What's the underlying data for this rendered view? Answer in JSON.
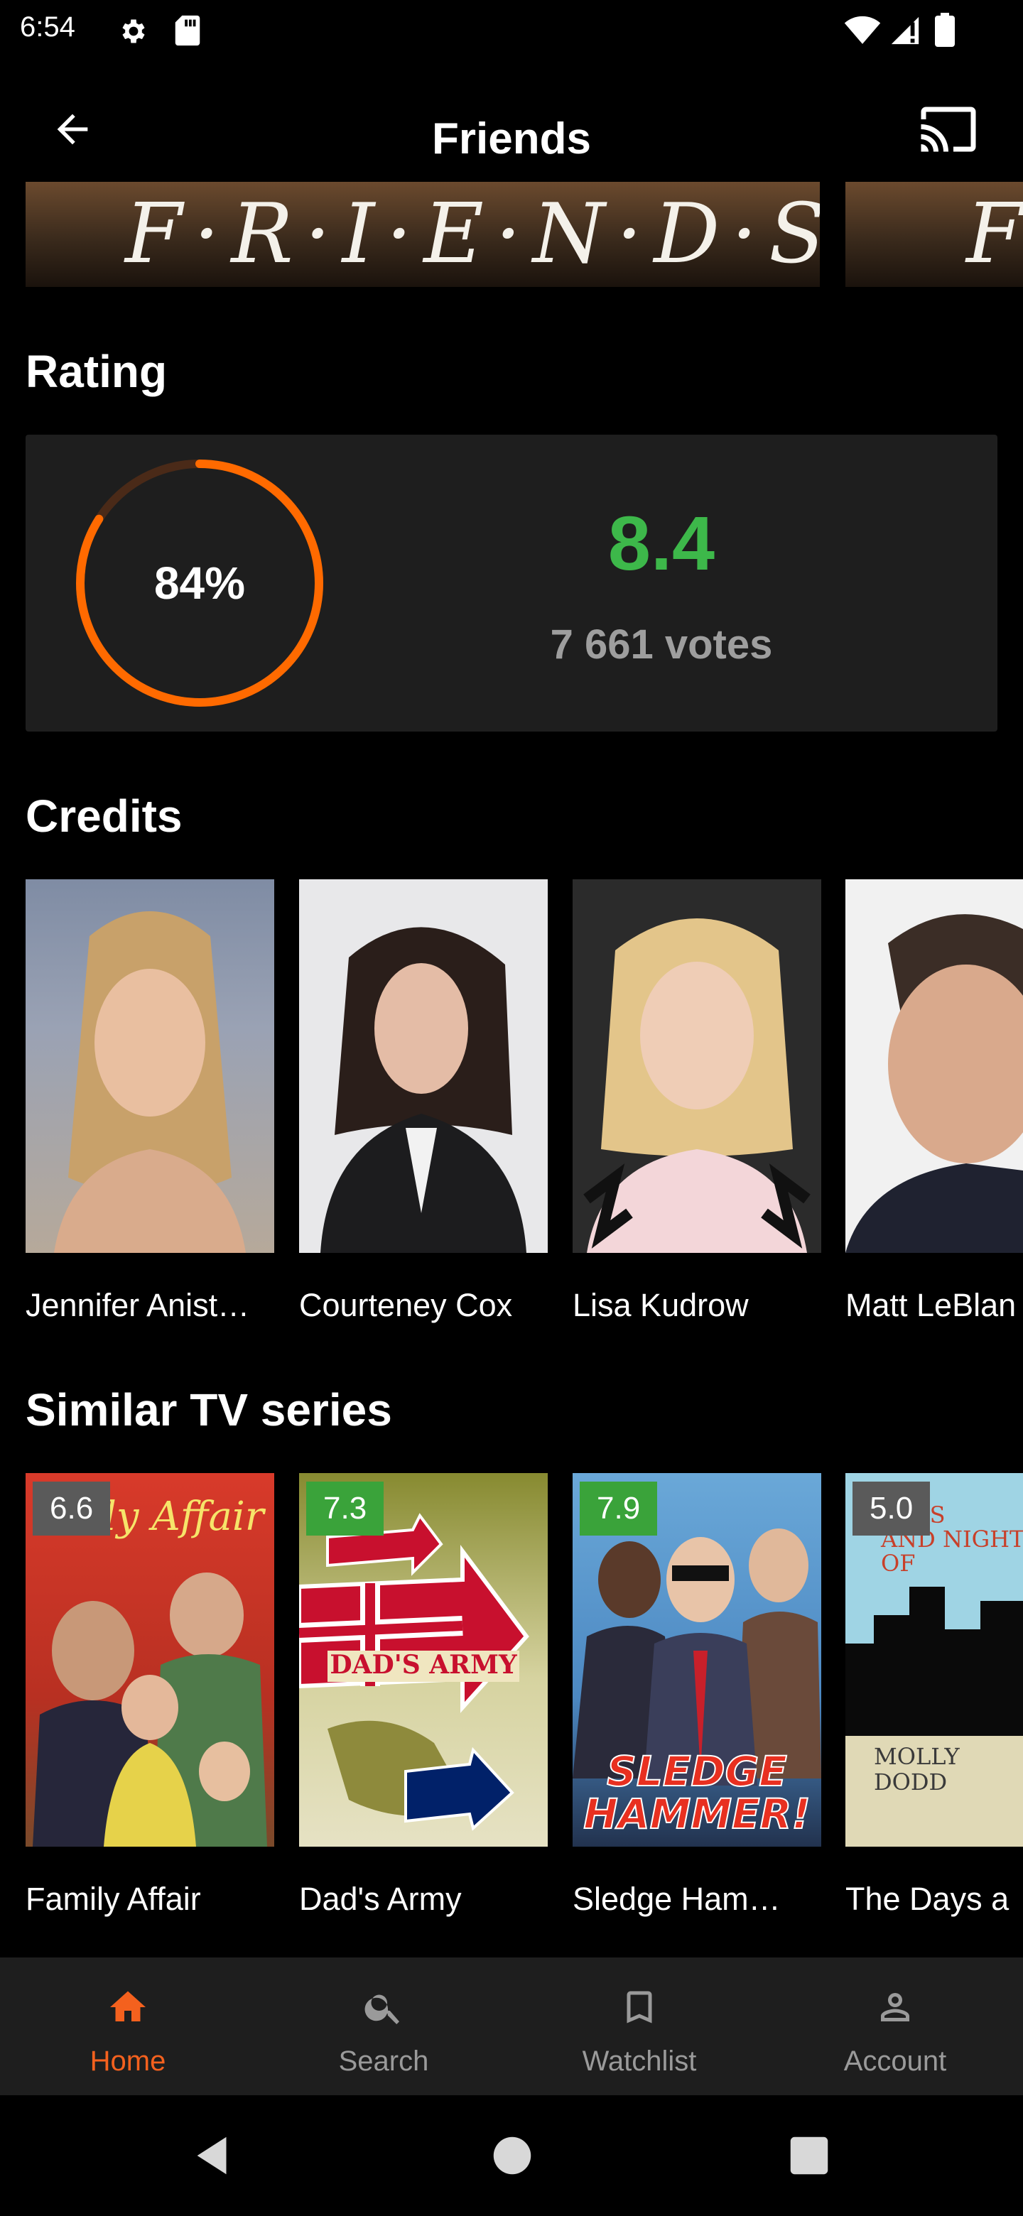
{
  "status_bar": {
    "time": "6:54",
    "icons": [
      "gear-icon",
      "sd-card-icon",
      "wifi-icon",
      "signal-icon",
      "battery-icon"
    ]
  },
  "app_bar": {
    "title": "Friends",
    "back_icon": "arrow-left-icon",
    "cast_icon": "cast-icon"
  },
  "backdrops": [
    {
      "logo_text": "F·R·I·E·N·D·S"
    },
    {
      "logo_text": "F"
    }
  ],
  "rating": {
    "heading": "Rating",
    "percent_label": "84%",
    "percent_value": 0.84,
    "score": "8.4",
    "votes": "7 661 votes",
    "ring_color": "#ff6a00",
    "score_color": "#3db84a"
  },
  "credits": {
    "heading": "Credits",
    "people": [
      {
        "name": "Jennifer Anist…"
      },
      {
        "name": "Courteney Cox"
      },
      {
        "name": "Lisa Kudrow"
      },
      {
        "name": "Matt LeBlan"
      }
    ]
  },
  "similar": {
    "heading": "Similar TV series",
    "series": [
      {
        "title": "Family Affair",
        "rating": "6.6",
        "badge_color": "#5a5a5a",
        "poster_text": "Family Affair"
      },
      {
        "title": "Dad's Army",
        "rating": "7.3",
        "badge_color": "#3aa33a",
        "poster_text": "DAD'S ARMY"
      },
      {
        "title": "Sledge Ham…",
        "rating": "7.9",
        "badge_color": "#3aa33a",
        "poster_text": "SLEDGE HAMMER!"
      },
      {
        "title": "The Days a",
        "rating": "5.0",
        "badge_color": "#5a5a5a",
        "poster_text_1": "DAYS AND NIGHTS OF",
        "poster_text_2": "MOLLY DODD"
      }
    ]
  },
  "bottom_nav": {
    "items": [
      {
        "label": "Home",
        "icon": "home-icon",
        "active": true
      },
      {
        "label": "Search",
        "icon": "search-icon",
        "active": false
      },
      {
        "label": "Watchlist",
        "icon": "bookmark-icon",
        "active": false
      },
      {
        "label": "Account",
        "icon": "account-icon",
        "active": false
      }
    ],
    "active_color": "#f4611e"
  }
}
